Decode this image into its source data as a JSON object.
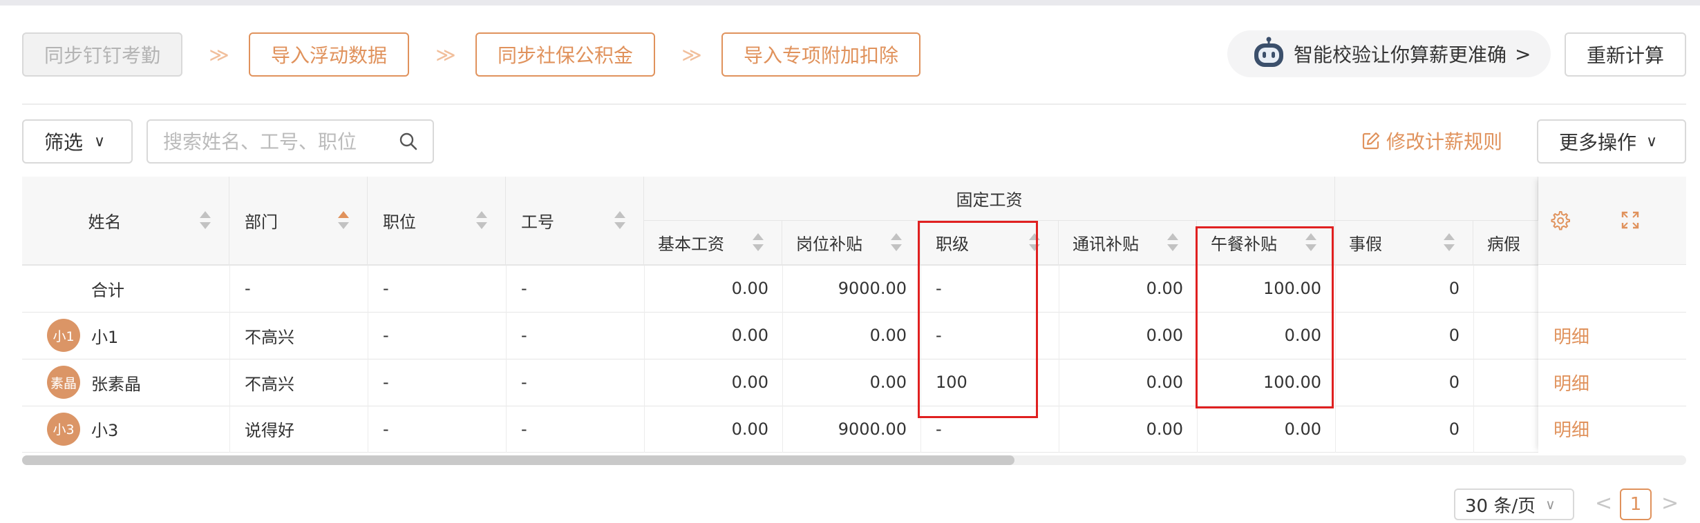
{
  "steps": [
    {
      "label": "同步钉钉考勤",
      "disabled": true
    },
    {
      "label": "导入浮动数据",
      "disabled": false
    },
    {
      "label": "同步社保公积金",
      "disabled": false
    },
    {
      "label": "导入专项附加扣除",
      "disabled": false
    }
  ],
  "step_arrow": "≫",
  "smart_check": {
    "text": "智能校验让你算薪更准确",
    "chevron": ">"
  },
  "recalc_label": "重新计算",
  "filter": {
    "label": "筛选",
    "chevron": "∨"
  },
  "search": {
    "placeholder": "搜索姓名、工号、职位",
    "value": ""
  },
  "edit_rule_label": "修改计薪规则",
  "more_actions": {
    "label": "更多操作",
    "chevron": "∨"
  },
  "table": {
    "group_header": "固定工资",
    "headers": {
      "name": "姓名",
      "dept": "部门",
      "position": "职位",
      "emp_no": "工号",
      "base_pay": "基本工资",
      "post_allowance": "岗位补贴",
      "grade": "职级",
      "comm_allowance": "通讯补贴",
      "lunch_allowance": "午餐补贴",
      "personal_leave": "事假",
      "sick_leave": "病假"
    },
    "summary": {
      "label": "合计",
      "dept": "-",
      "position": "-",
      "emp_no": "-",
      "base_pay": "0.00",
      "post_allowance": "9000.00",
      "grade": "-",
      "comm_allowance": "0.00",
      "lunch_allowance": "100.00",
      "personal_leave": "0"
    },
    "rows": [
      {
        "avatar": "小1",
        "name": "小1",
        "dept": "不高兴",
        "position": "-",
        "emp_no": "-",
        "base_pay": "0.00",
        "post_allowance": "0.00",
        "grade": "-",
        "comm_allowance": "0.00",
        "lunch_allowance": "0.00",
        "personal_leave": "0",
        "detail": "明细"
      },
      {
        "avatar": "素晶",
        "name": "张素晶",
        "dept": "不高兴",
        "position": "-",
        "emp_no": "-",
        "base_pay": "0.00",
        "post_allowance": "0.00",
        "grade": "100",
        "comm_allowance": "0.00",
        "lunch_allowance": "100.00",
        "personal_leave": "0",
        "detail": "明细"
      },
      {
        "avatar": "小3",
        "name": "小3",
        "dept": "说得好",
        "position": "-",
        "emp_no": "-",
        "base_pay": "0.00",
        "post_allowance": "9000.00",
        "grade": "-",
        "comm_allowance": "0.00",
        "lunch_allowance": "0.00",
        "personal_leave": "0",
        "detail": "明细"
      }
    ]
  },
  "pagination": {
    "page_size": "30 条/页",
    "prev": "<",
    "current": "1",
    "next": ">"
  },
  "colors": {
    "accent": "#e0925c",
    "highlight_box": "#e02020"
  }
}
